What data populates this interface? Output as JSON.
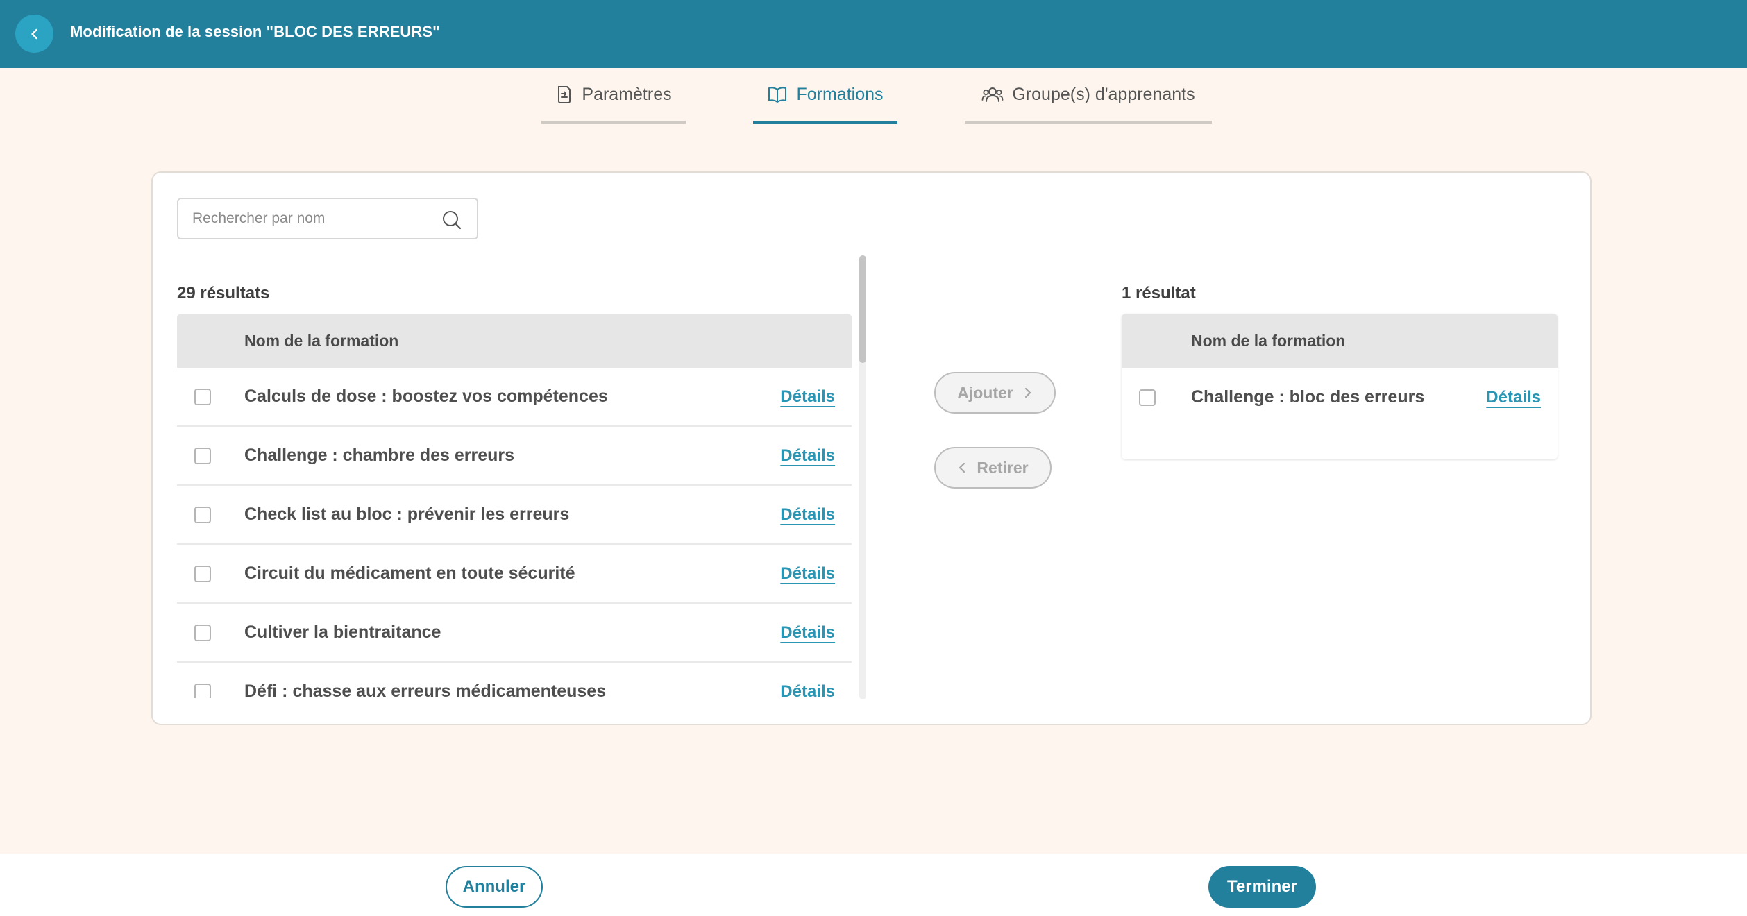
{
  "header": {
    "title": "Modification de la session \"BLOC DES ERREURS\"",
    "back_icon": "chevron-left-icon"
  },
  "tabs": [
    {
      "label": "Paramètres",
      "icon": "document-icon",
      "active": false
    },
    {
      "label": "Formations",
      "icon": "book-icon",
      "active": true
    },
    {
      "label": "Groupe(s) d'apprenants",
      "icon": "users-icon",
      "active": false
    }
  ],
  "search": {
    "placeholder": "Rechercher par nom",
    "icon": "search-icon"
  },
  "available": {
    "count_label": "29 résultats",
    "column_header": "Nom de la formation",
    "details_label": "Détails",
    "rows": [
      {
        "name": "Calculs de dose : boostez vos compétences"
      },
      {
        "name": "Challenge : chambre des erreurs"
      },
      {
        "name": "Check list au bloc : prévenir les erreurs"
      },
      {
        "name": "Circuit du médicament en toute sécurité"
      },
      {
        "name": "Cultiver la bientraitance"
      },
      {
        "name": "Défi : chasse aux erreurs médicamenteuses"
      }
    ]
  },
  "actions": {
    "add_label": "Ajouter",
    "remove_label": "Retirer"
  },
  "selected": {
    "count_label": "1 résultat",
    "column_header": "Nom de la formation",
    "details_label": "Détails",
    "rows": [
      {
        "name": "Challenge : bloc des erreurs"
      }
    ]
  },
  "footer": {
    "cancel_label": "Annuler",
    "finish_label": "Terminer"
  },
  "colors": {
    "primary": "#23809d",
    "link": "#2b96b4",
    "background": "#fef6ee"
  }
}
